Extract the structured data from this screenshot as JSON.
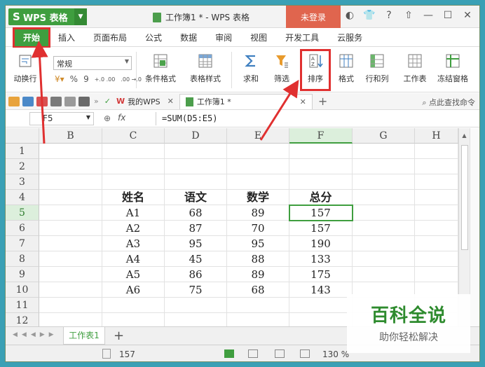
{
  "app": {
    "name": "WPS 表格",
    "window_title": "工作簿1 * - WPS 表格",
    "login": "未登录",
    "help": "?"
  },
  "menu": [
    "开始",
    "插入",
    "页面布局",
    "公式",
    "数据",
    "审阅",
    "视图",
    "开发工具",
    "云服务"
  ],
  "ribbon": {
    "wrap": "动换行",
    "font_name": "常规",
    "num_format": [
      "%",
      "9",
      "+.0 .00",
      ".00 →.0"
    ],
    "buttons": [
      "条件格式",
      "表格样式",
      "求和",
      "筛选",
      "排序",
      "格式",
      "行和列",
      "工作表",
      "冻结窗格"
    ]
  },
  "tabs": {
    "home": "我的WPS",
    "doc": "工作簿1 *",
    "search": "点此查找命令"
  },
  "formula": {
    "cell": "F5",
    "fx": "fx",
    "text": "=SUM(D5:E5)"
  },
  "columns": [
    "B",
    "C",
    "D",
    "E",
    "F",
    "G",
    "H"
  ],
  "rows": [
    "1",
    "2",
    "3",
    "4",
    "5",
    "6",
    "7",
    "8",
    "9",
    "10",
    "11",
    "12"
  ],
  "table": {
    "headers": [
      "姓名",
      "语文",
      "数学",
      "总分"
    ],
    "rows": [
      [
        "A1",
        "68",
        "89",
        "157"
      ],
      [
        "A2",
        "87",
        "70",
        "157"
      ],
      [
        "A3",
        "95",
        "95",
        "190"
      ],
      [
        "A4",
        "45",
        "88",
        "133"
      ],
      [
        "A5",
        "86",
        "89",
        "175"
      ],
      [
        "A6",
        "75",
        "68",
        "143"
      ]
    ]
  },
  "sheet": {
    "tab": "工作表1"
  },
  "status": {
    "sum": "157",
    "zoom": "130 %"
  },
  "watermark": {
    "title": "百科全说",
    "subtitle": "助你轻松解决"
  },
  "colors": {
    "accent": "#3f9e3f",
    "login": "#e0654e",
    "annotation": "#e03030"
  }
}
